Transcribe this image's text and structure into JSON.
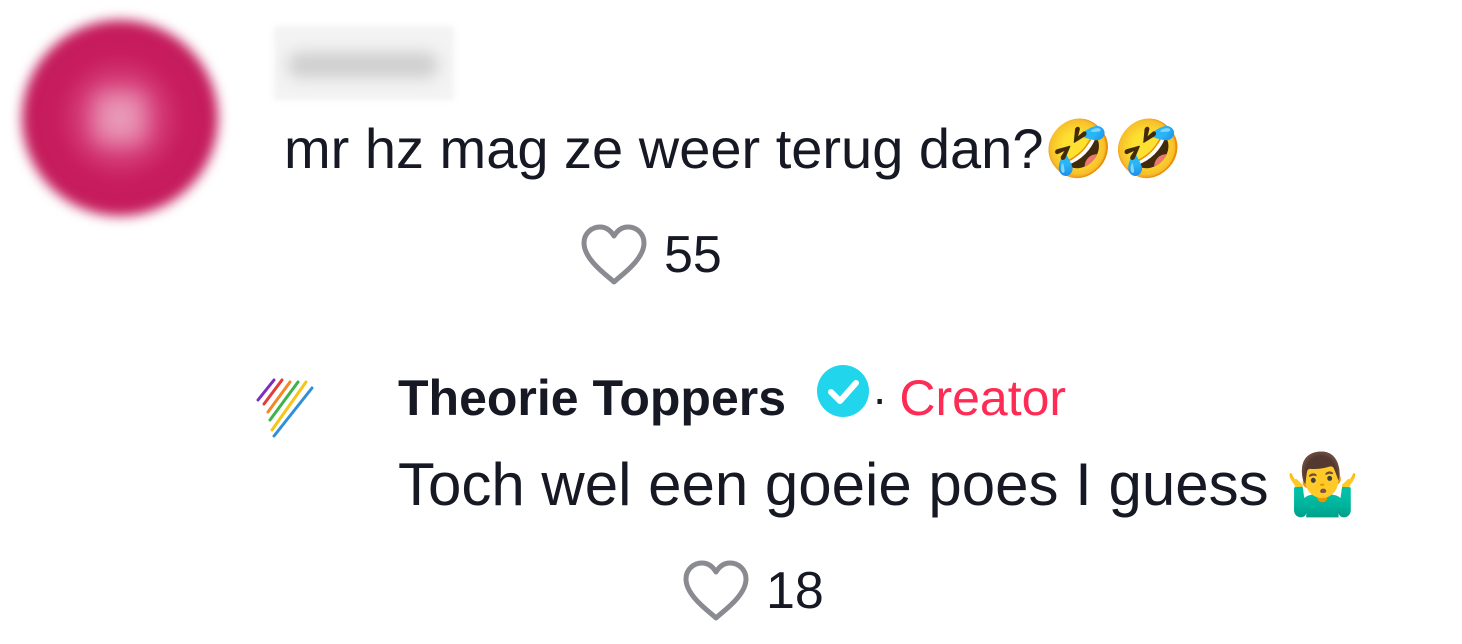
{
  "comment": {
    "username": "",
    "text": "mr hz mag ze weer terug dan?🤣🤣",
    "likes": "55",
    "avatar_color": "#c41c5c"
  },
  "reply": {
    "author": "Theorie Toppers",
    "separator": "·",
    "badge": "Creator",
    "text": "Toch wel een goeie poes I guess 🤷‍♂️",
    "likes": "18",
    "verified_color": "#20d5ec",
    "badge_color": "#fe2c55"
  },
  "icons": {
    "like": "heart-outline-icon",
    "verified": "verified-check-icon"
  }
}
